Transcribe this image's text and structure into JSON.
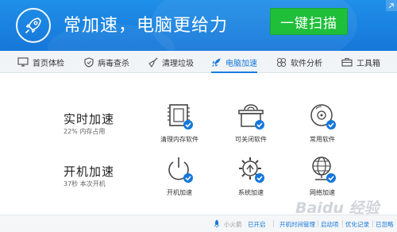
{
  "header": {
    "slogan": "常加速，电脑更给力",
    "scan_button": "一键扫描",
    "logo_icon": "rocket-icon",
    "accent_color": "#1677d9",
    "scan_color": "#1fbf3a"
  },
  "tabs": [
    {
      "label": "首页体检",
      "icon": "monitor-icon",
      "active": false
    },
    {
      "label": "病毒查杀",
      "icon": "shield-icon",
      "active": false
    },
    {
      "label": "清理垃圾",
      "icon": "broom-icon",
      "active": false
    },
    {
      "label": "电脑加速",
      "icon": "rocket-icon",
      "active": true
    },
    {
      "label": "软件分析",
      "icon": "apps-icon",
      "active": false
    },
    {
      "label": "工具箱",
      "icon": "toolbox-icon",
      "active": false
    }
  ],
  "realtime": {
    "title": "实时加速",
    "subtitle": "22% 内存占用",
    "tools": [
      {
        "label": "清理内存软件",
        "icon": "memory-chip-icon"
      },
      {
        "label": "可关闭软件",
        "icon": "software-box-icon"
      },
      {
        "label": "常用软件",
        "icon": "disc-icon"
      }
    ]
  },
  "boot": {
    "title": "开机加速",
    "subtitle": "37秒 本次开机",
    "tools": [
      {
        "label": "开机加速",
        "icon": "power-icon"
      },
      {
        "label": "系统加速",
        "icon": "gear-up-icon"
      },
      {
        "label": "网络加速",
        "icon": "globe-icon"
      }
    ]
  },
  "footer": {
    "item1_label": "小火箭",
    "item1_status": "已开启",
    "item2": "开机时间管理",
    "item3": "启动项",
    "item4": "优化记录",
    "item5": "已忽略",
    "watermark": "Baidu 经验"
  }
}
